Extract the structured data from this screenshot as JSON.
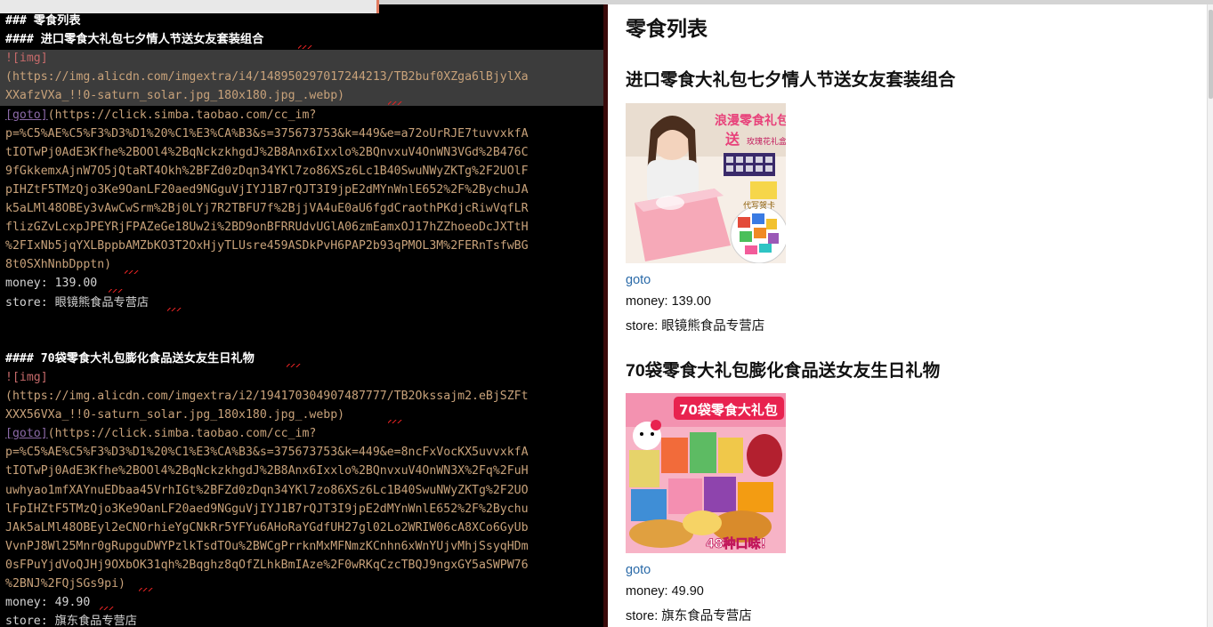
{
  "editor": {
    "lines": [
      {
        "t": "### 零食列表",
        "c": "hdr"
      },
      {
        "t": "#### 进口零食大礼包七夕情人节送女友套装组合",
        "c": "hdr"
      },
      {
        "t": "![img]",
        "c": "imgtag"
      },
      {
        "t": "(https://img.alicdn.com/imgextra/i4/148950297017244213/TB2buf0XZga6lBjylXa",
        "c": "url"
      },
      {
        "t": "XXafzVXa_!!0-saturn_solar.jpg_180x180.jpg_.webp)",
        "c": "url"
      },
      {
        "t": "[goto](https://click.simba.taobao.com/cc_im?",
        "c": "goto"
      },
      {
        "t": "p=%C5%AE%C5%F3%D3%D1%20%C1%E3%CA%B3&s=375673753&k=449&e=a72oUrRJE7tuvvxkfA",
        "c": "url"
      },
      {
        "t": "tIOTwPj0AdE3Kfhe%2BOOl4%2BqNckzkhgdJ%2B8Anx6Ixxlo%2BQnvxuV4OnWN3VGd%2B476C",
        "c": "url"
      },
      {
        "t": "9fGkkemxAjnW7O5jQtaRT4Okh%2BFZd0zDqn34YKl7zo86XSz6Lc1B40SwuNWyZKTg%2F2UOlF",
        "c": "url"
      },
      {
        "t": "pIHZtF5TMzQjo3Ke9OanLF20aed9NGguVjIYJ1B7rQJT3I9jpE2dMYnWnlE652%2F%2BychuJA",
        "c": "url"
      },
      {
        "t": "k5aLMl48OBEy3vAwCwSrm%2Bj0LYj7R2TBFU7f%2BjjVA4uE0aU6fgdCraothPKdjcRiwVqfLR",
        "c": "url"
      },
      {
        "t": "flizGZvLcxpJPEYRjFPAZeGe18Uw2i%2BD9onBFRRUdvUGlA06zmEamxOJ17hZZhoeoDcJXTtH",
        "c": "url"
      },
      {
        "t": "%2FIxNb5jqYXLBppbAMZbKO3T2OxHjyTLUsre459ASDkPvH6PAP2b93qPMOL3M%2FERnTsfwBG",
        "c": "url"
      },
      {
        "t": "8t0SXhNnbDpptn)",
        "c": "url"
      },
      {
        "t": "money: 139.00",
        "c": "plain"
      },
      {
        "t": "store: 眼镜熊食品专营店",
        "c": "plain"
      },
      {
        "t": "",
        "c": "plain"
      },
      {
        "t": "",
        "c": "plain"
      },
      {
        "t": "#### 70袋零食大礼包膨化食品送女友生日礼物",
        "c": "hdr"
      },
      {
        "t": "![img]",
        "c": "imgtag"
      },
      {
        "t": "(https://img.alicdn.com/imgextra/i2/194170304907487777/TB2Okssajm2.eBjSZFt",
        "c": "url"
      },
      {
        "t": "XXX56VXa_!!0-saturn_solar.jpg_180x180.jpg_.webp)",
        "c": "url"
      },
      {
        "t": "[goto](https://click.simba.taobao.com/cc_im?",
        "c": "goto"
      },
      {
        "t": "p=%C5%AE%C5%F3%D3%D1%20%C1%E3%CA%B3&s=375673753&k=449&e=8ncFxVocKX5uvvxkfA",
        "c": "url"
      },
      {
        "t": "tIOTwPj0AdE3Kfhe%2BOOl4%2BqNckzkhgdJ%2B8Anx6Ixxlo%2BQnvxuV4OnWN3X%2Fq%2FuH",
        "c": "url"
      },
      {
        "t": "uwhyao1mfXAYnuEDbaa45VrhIGt%2BFZd0zDqn34YKl7zo86XSz6Lc1B40SwuNWyZKTg%2F2UO",
        "c": "url"
      },
      {
        "t": "lFpIHZtF5TMzQjo3Ke9OanLF20aed9NGguVjIYJ1B7rQJT3I9jpE2dMYnWnlE652%2F%2Bychu",
        "c": "url"
      },
      {
        "t": "JAk5aLMl48OBEyl2eCNOrhieYgCNkRr5YFYu6AHoRaYGdfUH27gl02Lo2WRIW06cA8XCo6GyUb",
        "c": "url"
      },
      {
        "t": "VvnPJ8Wl25Mnr0gRupguDWYPzlkTsdTOu%2BWCgPrrknMxMFNmzKCnhn6xWnYUjvMhjSsyqHDm",
        "c": "url"
      },
      {
        "t": "0sFPuYjdVoQJHj9OXbOK31qh%2Bqghz8qOfZLhkBmIAze%2F0wRKqCzcTBQJ9ngxGY5aSWPW76",
        "c": "url"
      },
      {
        "t": "%2BNJ%2FQjSGs9pi)",
        "c": "url"
      },
      {
        "t": "money: 49.90",
        "c": "plain"
      },
      {
        "t": "store: 旗东食品专营店",
        "c": "plain"
      }
    ]
  },
  "preview": {
    "title": "零食列表",
    "items": [
      {
        "name": "进口零食大礼包七夕情人节送女友套装组合",
        "img_banner": "浪漫零食礼包",
        "img_sub1": "送",
        "img_sub2": "玫瑰花礼盒",
        "img_sub3": "代写贺卡",
        "link": "goto",
        "money": "money: 139.00",
        "store": "store: 眼镜熊食品专营店"
      },
      {
        "name": "70袋零食大礼包膨化食品送女友生日礼物",
        "img_banner": "70袋零食大礼包",
        "img_bottom": "48种口味!",
        "link": "goto",
        "money": "money: 49.90",
        "store": "store: 旗东食品专营店"
      }
    ]
  },
  "colors": {
    "editor_bg": "#000000",
    "header_text": "#ffffff",
    "url_text": "#c8a27a",
    "img_tag": "#c66a6a",
    "goto_tag": "#8c6aa8",
    "link": "#2a6aa8"
  }
}
